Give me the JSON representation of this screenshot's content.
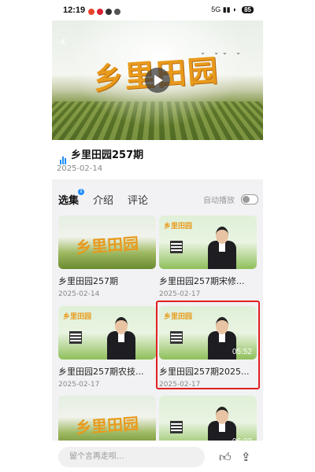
{
  "status": {
    "time": "12:19",
    "network": "5G",
    "battery": "85"
  },
  "player": {
    "logo_text": "乡里田园"
  },
  "video": {
    "title": "乡里田园257期",
    "date": "2025-02-14"
  },
  "tabs": {
    "episodes": "选集",
    "intro": "介绍",
    "comments": "评论",
    "autoplay": "自动播放"
  },
  "episodes": [
    {
      "title": "乡里田园257期",
      "date": "2025-02-14",
      "logo": "乡里田园"
    },
    {
      "title": "乡里田园257期宋修...",
      "date": "2025-02-17",
      "logo": "乡里田园"
    },
    {
      "title": "乡里田园257期农技...",
      "date": "2025-02-17",
      "logo": "乡里田园"
    },
    {
      "title": "乡里田园257期2025...",
      "date": "2025-02-17",
      "duration": "05:52",
      "logo": "乡里田园"
    },
    {
      "logo": "乡里田园"
    },
    {
      "duration": "06:22"
    }
  ],
  "bottom": {
    "comment_placeholder": "留个言再走呗..."
  },
  "icons": {
    "back": "back-arrow-icon",
    "play": "play-icon",
    "playing": "playing-bars-icon",
    "like": "thumbs-up-icon",
    "share": "share-icon"
  }
}
